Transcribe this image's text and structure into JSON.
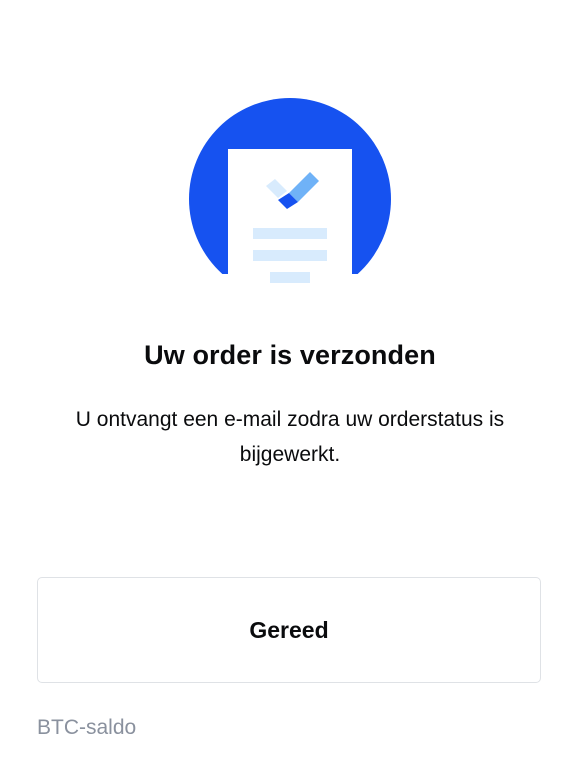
{
  "illustration": {
    "icon": "order-document-check-icon",
    "circle_color": "#1652f0",
    "check_color": "#1652f0",
    "check_light_color": "#6fb2f7",
    "line_color": "#d8ebfd"
  },
  "confirmation": {
    "title": "Uw order is verzonden",
    "message": "U ontvangt een e-mail zodra uw orderstatus is bijgewerkt."
  },
  "actions": {
    "done_label": "Gereed"
  },
  "footer": {
    "balance_label": "BTC-saldo"
  }
}
